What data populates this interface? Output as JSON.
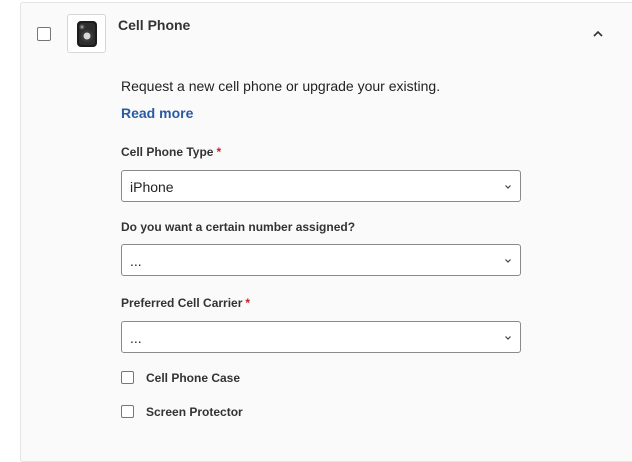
{
  "item": {
    "title": "Cell Phone",
    "thumbnail_icon": "cell-phone-icon",
    "toggle_icon": "chevron-up-icon",
    "description": "Request a new cell phone or upgrade your existing.",
    "read_more": "Read more"
  },
  "fields": {
    "phone_type": {
      "label": "Cell Phone Type",
      "required_marker": "*",
      "value": "iPhone"
    },
    "number_assigned": {
      "label": "Do you want a certain number assigned?",
      "value": "..."
    },
    "carrier": {
      "label": "Preferred Cell Carrier",
      "required_marker": "*",
      "value": "..."
    }
  },
  "options": [
    {
      "label": "Cell Phone Case",
      "checked": false
    },
    {
      "label": "Screen Protector",
      "checked": false
    }
  ],
  "colors": {
    "link": "#2b5aa3",
    "required": "#c8202a",
    "border": "#8a8a8a",
    "card_bg": "#fafafa"
  }
}
